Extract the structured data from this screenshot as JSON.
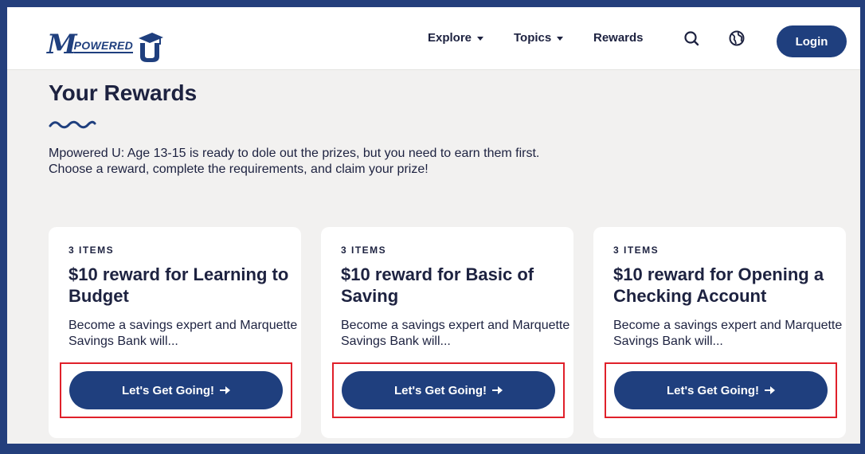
{
  "logo": {
    "mark": "M",
    "text": "POWERED",
    "u": "U",
    "tm": "™"
  },
  "nav": {
    "items": [
      {
        "label": "Explore",
        "has_menu": true
      },
      {
        "label": "Topics",
        "has_menu": true
      },
      {
        "label": "Rewards",
        "has_menu": false
      }
    ],
    "icons": [
      "search-icon",
      "globe-icon"
    ],
    "login_label": "Login"
  },
  "page": {
    "title": "Your Rewards",
    "intro": "Mpowered U: Age 13-15 is ready to dole out the prizes, but you need to earn them first. Choose a reward, complete the requirements, and claim your prize!"
  },
  "rewards": [
    {
      "count": "3 ITEMS",
      "title": "$10 reward for Learning to Budget",
      "description": "Become a savings expert and Marquette Savings Bank will...",
      "cta": "Let's Get Going!"
    },
    {
      "count": "3 ITEMS",
      "title": "$10 reward for Basic of Saving",
      "description": "Become a savings expert and Marquette Savings Bank will...",
      "cta": "Let's Get Going!"
    },
    {
      "count": "3 ITEMS",
      "title": "$10 reward for Opening a Checking Account",
      "description": "Become a savings expert and Marquette Savings Bank will...",
      "cta": "Let's Get Going!"
    }
  ],
  "colors": {
    "brand": "#1f3f7e",
    "text": "#1d2240",
    "background": "#f2f1f0",
    "frame": "#243f7c",
    "highlight": "#e0202a"
  }
}
